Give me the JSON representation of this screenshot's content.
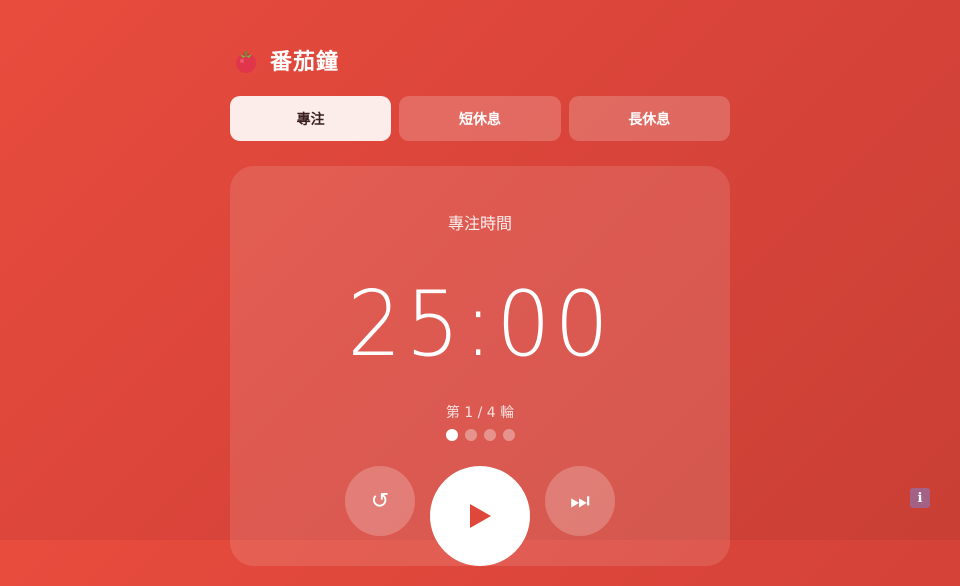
{
  "app": {
    "title": "番茄鐘",
    "logo_icon": "tomato-icon"
  },
  "tabs": [
    {
      "label": "專注",
      "active": true
    },
    {
      "label": "短休息",
      "active": false
    },
    {
      "label": "長休息",
      "active": false
    }
  ],
  "timer": {
    "mode_label": "專注時間",
    "time": "25:00",
    "round_text": "第 1 / 4 輪",
    "rounds_total": 4,
    "rounds_current": 1
  },
  "controls": {
    "reset_icon": "↺",
    "play_icon": "play-icon",
    "skip_icon": "⏭"
  },
  "info": {
    "icon_text": "i"
  },
  "colors": {
    "background": "#e04a3c",
    "active_tab_bg": "#fcecea",
    "play_triangle": "#e0473b"
  }
}
